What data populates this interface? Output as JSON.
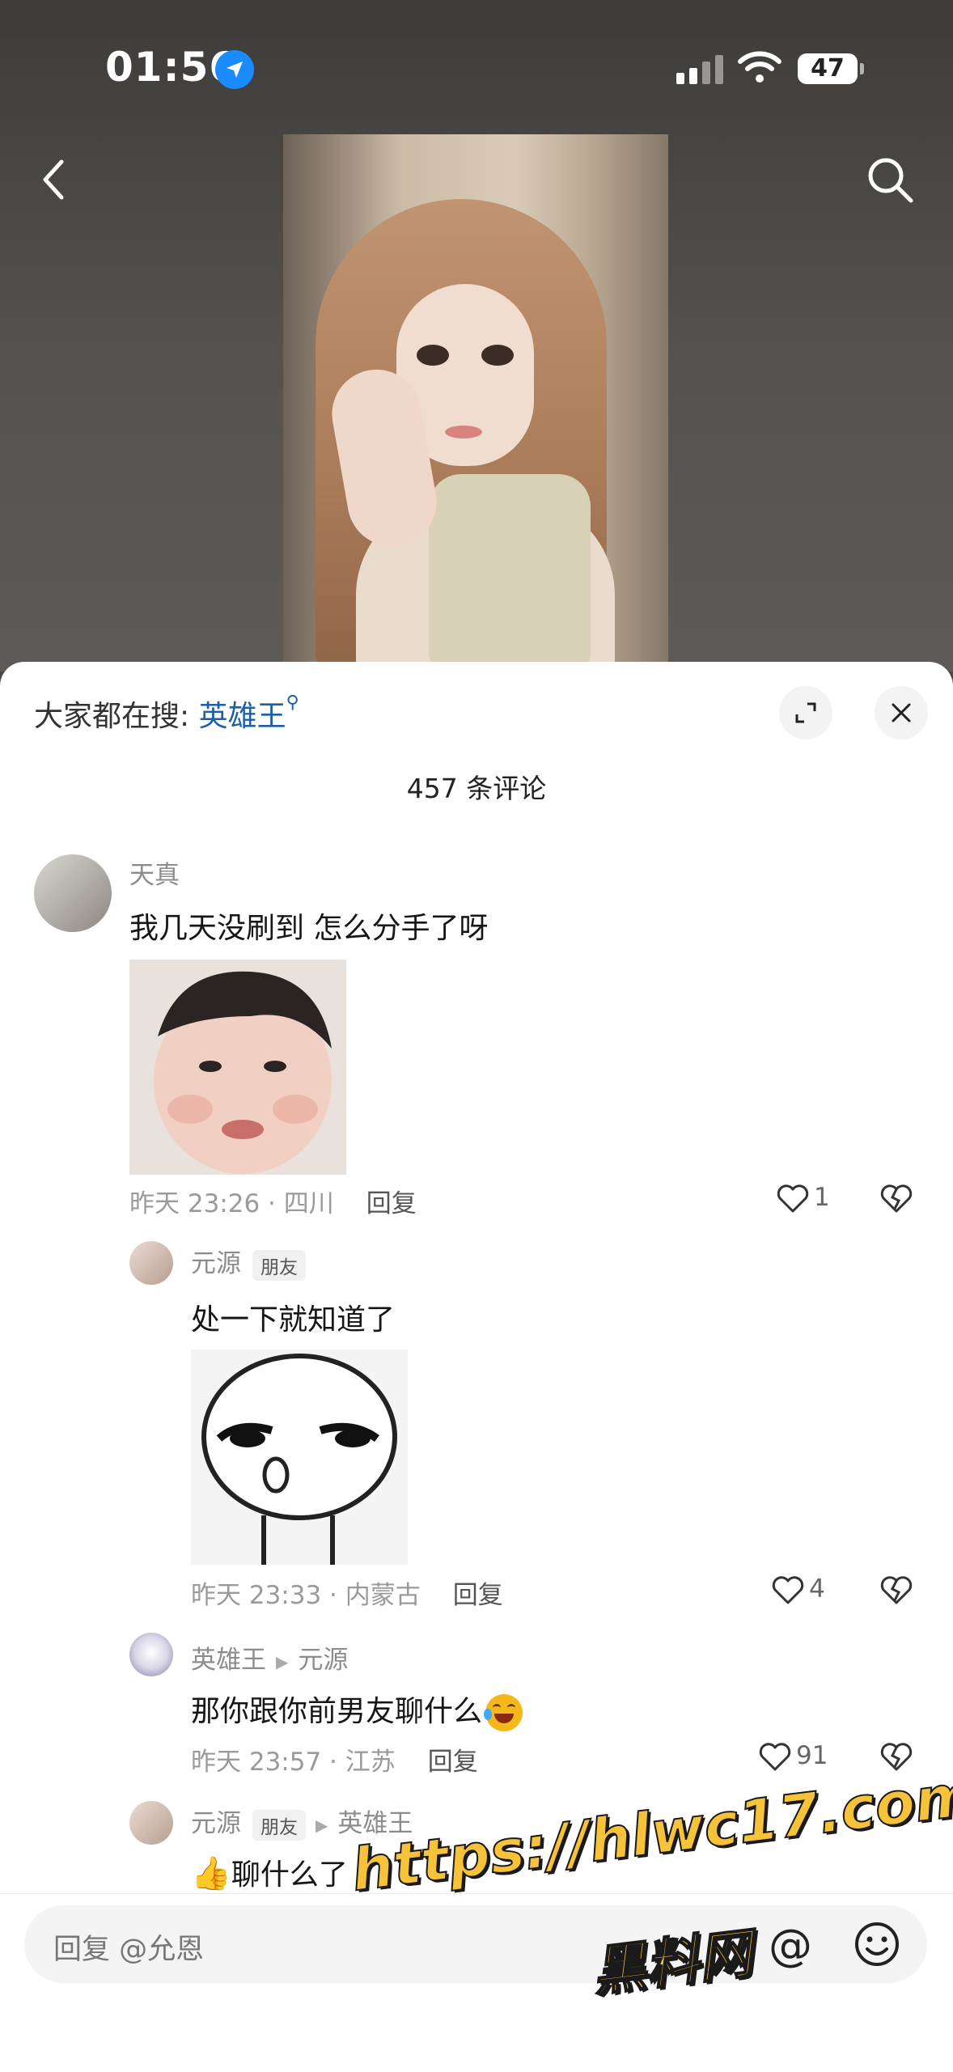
{
  "status_bar": {
    "time": "01:56",
    "battery": "47"
  },
  "hot_search": {
    "prefix": "大家都在搜: ",
    "keyword": "英雄王",
    "icon": "search-mini-icon"
  },
  "comment_count": "457 条评论",
  "comments": [
    {
      "user": "天真",
      "text": "我几天没刷到 怎么分手了呀",
      "time_location": "昨天 23:26 · 四川",
      "reply_label": "回复",
      "likes": "1"
    },
    {
      "user": "元源",
      "tag": "朋友",
      "text": "处一下就知道了",
      "time_location": "昨天 23:33 · 内蒙古",
      "reply_label": "回复",
      "likes": "4"
    },
    {
      "user": "英雄王",
      "reply_to": "元源",
      "text": "那你跟你前男友聊什么",
      "time_location": "昨天 23:57 · 江苏",
      "reply_label": "回复",
      "likes": "91"
    },
    {
      "user": "元源",
      "tag": "朋友",
      "reply_to": "英雄王",
      "text": "聊什么了"
    }
  ],
  "input": {
    "placeholder": "回复 @允恩"
  },
  "watermark": {
    "line1": "https://hlwc17.com",
    "line2": "黑料网"
  },
  "colors": {
    "keyword": "#1f5fa8",
    "location_badge": "#1a8cff",
    "watermark": "#f5c23a"
  }
}
